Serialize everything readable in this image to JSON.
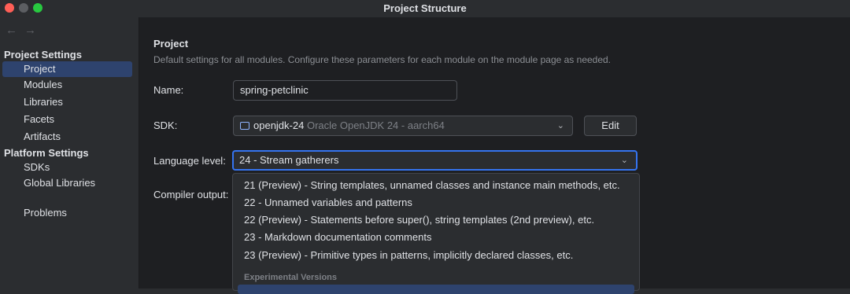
{
  "window": {
    "title": "Project Structure"
  },
  "sidebar": {
    "sections": [
      {
        "label": "Project Settings",
        "items": [
          {
            "label": "Project",
            "selected": true
          },
          {
            "label": "Modules"
          },
          {
            "label": "Libraries"
          },
          {
            "label": "Facets"
          },
          {
            "label": "Artifacts"
          }
        ]
      },
      {
        "label": "Platform Settings",
        "items": [
          {
            "label": "SDKs"
          },
          {
            "label": "Global Libraries"
          }
        ]
      }
    ],
    "extra_items": [
      {
        "label": "Problems"
      }
    ]
  },
  "main": {
    "heading": "Project",
    "description": "Default settings for all modules. Configure these parameters for each module on the module page as needed.",
    "name": {
      "label": "Name:",
      "value": "spring-petclinic"
    },
    "sdk": {
      "label": "SDK:",
      "value": "openjdk-24",
      "hint": "Oracle OpenJDK 24 - aarch64",
      "edit_label": "Edit"
    },
    "language_level": {
      "label": "Language level:",
      "value": "24 - Stream gatherers"
    },
    "compiler_output": {
      "label": "Compiler output:"
    }
  },
  "dropdown": {
    "options": [
      "21 (Preview) - String templates, unnamed classes and instance main methods, etc.",
      "22 - Unnamed variables and patterns",
      "22 (Preview) - Statements before super(), string templates (2nd preview), etc.",
      "23 - Markdown documentation comments",
      "23 (Preview) - Primitive types in patterns, implicitly declared classes, etc."
    ],
    "separator": "Experimental Versions"
  },
  "colors": {
    "accent": "#3574f0",
    "selection": "#2e436e"
  }
}
